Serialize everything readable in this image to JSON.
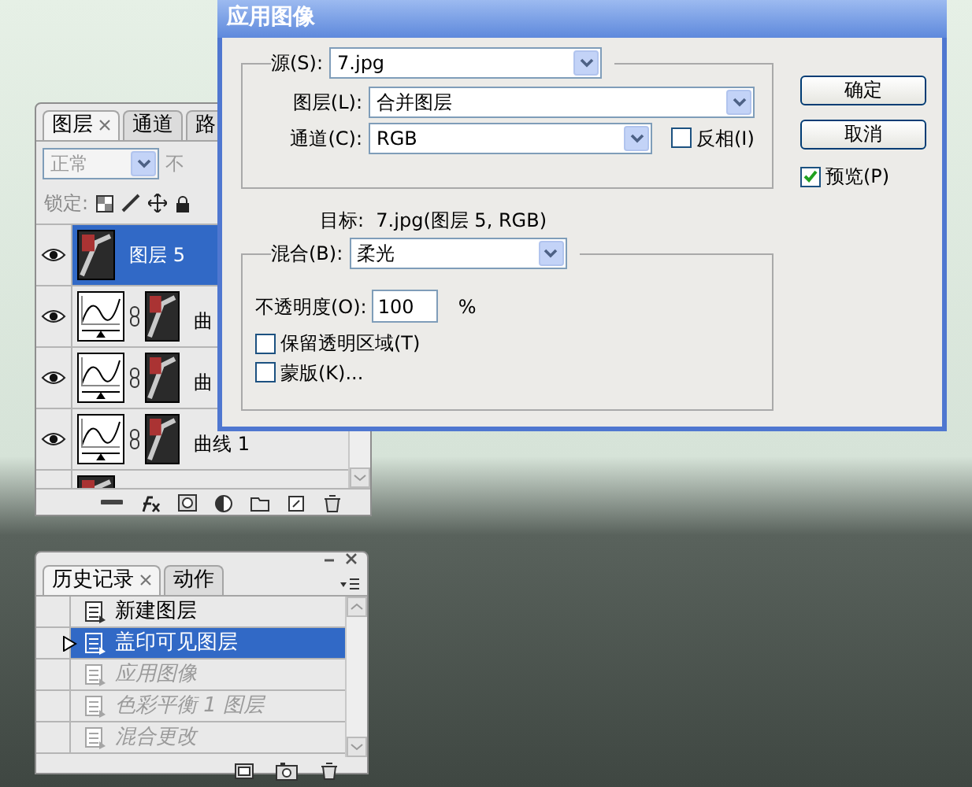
{
  "dialog": {
    "title": "应用图像",
    "source": {
      "label": "源(S):",
      "value": "7.jpg"
    },
    "layer": {
      "label": "图层(L):",
      "value": "合并图层"
    },
    "channel": {
      "label": "通道(C):",
      "value": "RGB"
    },
    "invert": {
      "label": "反相(I)",
      "checked": false
    },
    "target": "目标:  7.jpg(图层 5, RGB)",
    "blending": {
      "label": "混合(B):",
      "value": "柔光"
    },
    "opacity": {
      "label": "不透明度(O):",
      "value": "100",
      "unit": "%"
    },
    "options": [
      {
        "label": "保留透明区域(T)",
        "checked": false
      },
      {
        "label": "蒙版(K)...",
        "checked": false
      }
    ],
    "buttons": [
      "确定",
      "取消"
    ],
    "preview": {
      "label": "预览(P)",
      "checked": true
    }
  },
  "layers_panel": {
    "tabs": [
      {
        "label": "图层",
        "selected": true,
        "closable": true
      },
      {
        "label": "通道",
        "selected": false,
        "closable": false
      },
      {
        "label": "路",
        "selected": false,
        "closable": false
      }
    ],
    "blend_mode": {
      "value": "正常",
      "disabled": true
    },
    "opacity_label": "不",
    "lock_label": "锁定:",
    "layers": [
      {
        "kind": "pixel",
        "name": "图层 5",
        "visible": true,
        "selected": true
      },
      {
        "kind": "curves",
        "name": "曲",
        "visible": true,
        "selected": false
      },
      {
        "kind": "curves",
        "name": "曲",
        "visible": true,
        "selected": false
      },
      {
        "kind": "curves",
        "name": "曲线 1",
        "visible": true,
        "selected": false
      },
      {
        "kind": "pixel",
        "selected": false
      }
    ]
  },
  "history_panel": {
    "tabs": [
      {
        "label": "历史记录",
        "selected": true,
        "closable": true
      },
      {
        "label": "动作",
        "selected": false,
        "closable": false
      }
    ],
    "items": [
      {
        "label": "新建图层",
        "selected": false,
        "undone": false,
        "source": false
      },
      {
        "label": "盖印可见图层",
        "selected": true,
        "undone": false,
        "source": true
      },
      {
        "label": "应用图像",
        "selected": false,
        "undone": true,
        "source": false
      },
      {
        "label": "色彩平衡 1 图层",
        "selected": false,
        "undone": true,
        "source": false
      },
      {
        "label": "混合更改",
        "selected": false,
        "undone": true,
        "source": false
      }
    ]
  }
}
